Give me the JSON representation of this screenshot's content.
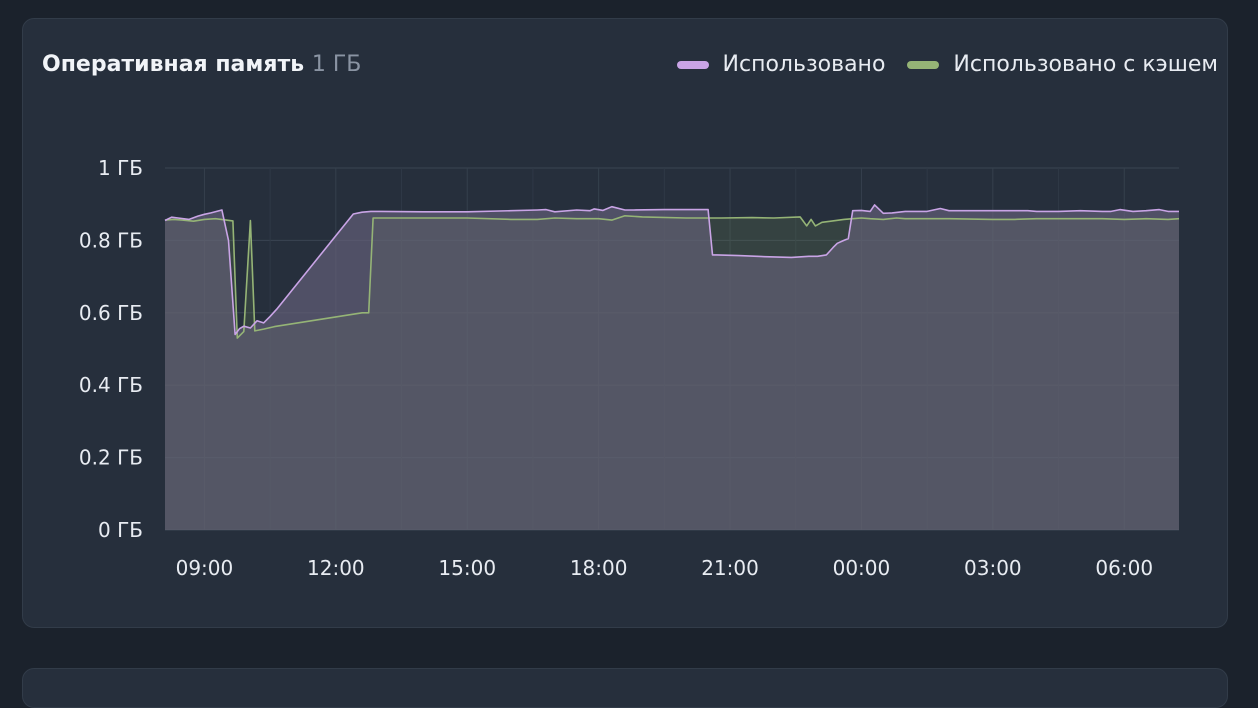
{
  "card": {
    "title": "Оперативная память",
    "subtitle": "1 ГБ"
  },
  "chart_data": {
    "type": "area",
    "title": "Оперативная память",
    "subtitle": "1 ГБ",
    "xlabel": "",
    "ylabel": "",
    "x_unit": "hours",
    "xlim": [
      8.1,
      31.25
    ],
    "ylim": [
      0,
      1
    ],
    "x_ticks": [
      9,
      12,
      15,
      18,
      21,
      24,
      27,
      30
    ],
    "x_tick_labels": [
      "09:00",
      "12:00",
      "15:00",
      "18:00",
      "21:00",
      "00:00",
      "03:00",
      "06:00"
    ],
    "y_ticks": [
      0,
      0.2,
      0.4,
      0.6,
      0.8,
      1
    ],
    "y_tick_labels": [
      "0 ГБ",
      "0.2 ГБ",
      "0.4 ГБ",
      "0.6 ГБ",
      "0.8 ГБ",
      "1 ГБ"
    ],
    "grid": true,
    "legend_position": "top-right",
    "series": [
      {
        "name": "Использовано",
        "color": "#c9a4e6",
        "x": [
          8.1,
          8.25,
          8.4,
          8.65,
          8.85,
          9.0,
          9.15,
          9.4,
          9.55,
          9.7,
          9.8,
          9.9,
          10.05,
          10.2,
          10.35,
          10.5,
          10.65,
          12.4,
          12.6,
          12.8,
          13.0,
          14.0,
          15.0,
          16.0,
          16.6,
          16.8,
          17.0,
          17.5,
          17.8,
          17.9,
          18.1,
          18.3,
          18.6,
          18.8,
          19.5,
          20.0,
          20.3,
          20.5,
          20.6,
          20.7,
          21.2,
          21.8,
          22.4,
          22.8,
          23.0,
          23.2,
          23.35,
          23.45,
          23.6,
          23.7,
          23.8,
          24.0,
          24.2,
          24.3,
          24.5,
          24.7,
          25.0,
          25.3,
          25.5,
          25.8,
          26.0,
          26.5,
          27.0,
          27.5,
          27.8,
          28.0,
          28.5,
          29.0,
          29.5,
          29.7,
          29.9,
          30.2,
          30.5,
          30.8,
          31.0,
          31.25
        ],
        "values": [
          0.855,
          0.864,
          0.862,
          0.858,
          0.867,
          0.872,
          0.876,
          0.884,
          0.8,
          0.54,
          0.556,
          0.563,
          0.558,
          0.578,
          0.572,
          0.59,
          0.61,
          0.873,
          0.878,
          0.88,
          0.88,
          0.879,
          0.879,
          0.882,
          0.884,
          0.885,
          0.879,
          0.884,
          0.882,
          0.887,
          0.883,
          0.893,
          0.884,
          0.884,
          0.885,
          0.885,
          0.885,
          0.885,
          0.76,
          0.76,
          0.758,
          0.755,
          0.753,
          0.756,
          0.756,
          0.76,
          0.78,
          0.792,
          0.8,
          0.805,
          0.882,
          0.883,
          0.88,
          0.898,
          0.875,
          0.876,
          0.88,
          0.88,
          0.88,
          0.888,
          0.882,
          0.882,
          0.882,
          0.882,
          0.882,
          0.88,
          0.88,
          0.882,
          0.88,
          0.88,
          0.885,
          0.88,
          0.882,
          0.885,
          0.88,
          0.88
        ]
      },
      {
        "name": "Использовано с кэшем",
        "color": "#95b476",
        "x": [
          8.1,
          8.3,
          8.5,
          8.75,
          9.0,
          9.25,
          9.5,
          9.65,
          9.75,
          9.9,
          10.05,
          10.15,
          10.35,
          10.6,
          12.6,
          12.75,
          12.85,
          14.0,
          15.0,
          16.0,
          16.6,
          17.0,
          17.5,
          18.0,
          18.3,
          18.6,
          19.0,
          20.0,
          20.5,
          20.8,
          21.5,
          22.0,
          22.6,
          22.75,
          22.85,
          22.95,
          23.1,
          23.3,
          23.6,
          23.8,
          24.0,
          24.2,
          24.5,
          24.8,
          25.0,
          25.5,
          26.0,
          27.0,
          27.5,
          28.0,
          28.5,
          29.0,
          29.5,
          30.0,
          30.5,
          31.0,
          31.25
        ],
        "values": [
          0.856,
          0.858,
          0.856,
          0.853,
          0.858,
          0.86,
          0.856,
          0.854,
          0.53,
          0.548,
          0.855,
          0.55,
          0.555,
          0.562,
          0.6,
          0.6,
          0.862,
          0.862,
          0.862,
          0.858,
          0.858,
          0.862,
          0.86,
          0.86,
          0.856,
          0.868,
          0.865,
          0.862,
          0.862,
          0.862,
          0.863,
          0.862,
          0.865,
          0.84,
          0.858,
          0.84,
          0.85,
          0.853,
          0.858,
          0.86,
          0.862,
          0.86,
          0.858,
          0.862,
          0.86,
          0.86,
          0.86,
          0.858,
          0.858,
          0.86,
          0.86,
          0.86,
          0.86,
          0.858,
          0.86,
          0.858,
          0.86
        ]
      }
    ]
  }
}
